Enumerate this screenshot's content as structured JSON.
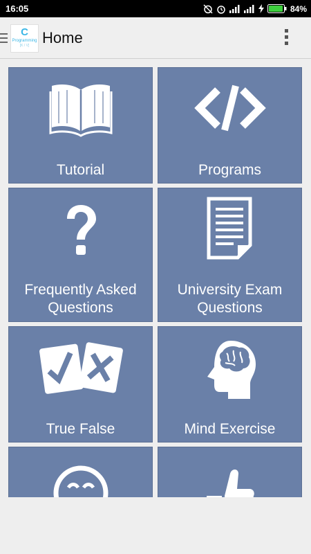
{
  "status_bar": {
    "time": "16:05",
    "battery_percent": "84%"
  },
  "app_bar": {
    "title": "Home",
    "logo": {
      "letter": "C",
      "line1": "Programming",
      "line2": "[K / V]"
    }
  },
  "tiles": [
    {
      "label": "Tutorial",
      "icon": "book-icon"
    },
    {
      "label": "Programs",
      "icon": "code-icon"
    },
    {
      "label_lines": [
        "Frequently Asked",
        "Questions"
      ],
      "icon": "question-icon"
    },
    {
      "label_lines": [
        "University Exam",
        "Questions"
      ],
      "icon": "document-icon"
    },
    {
      "label": "True False",
      "icon": "true-false-icon"
    },
    {
      "label": "Mind Exercise",
      "icon": "brain-head-icon"
    },
    {
      "label": "",
      "icon": "smiley-icon"
    },
    {
      "label": "",
      "icon": "thumbs-up-icon"
    }
  ],
  "colors": {
    "tile_bg": "#6a80a8",
    "accent": "#39b6e6"
  }
}
